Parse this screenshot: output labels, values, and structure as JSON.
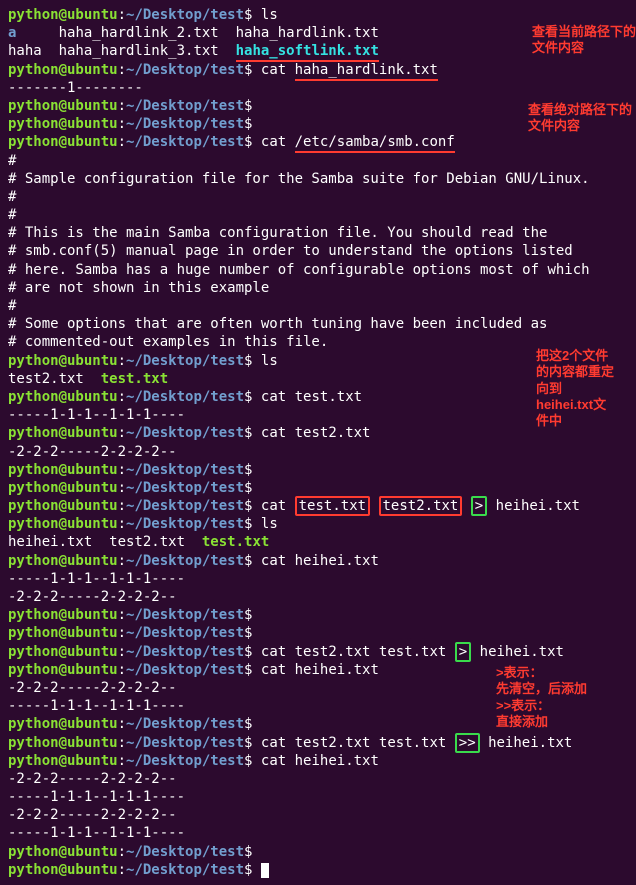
{
  "prompt": {
    "user": "python@ubuntu",
    "sep": ":",
    "path": "~/Desktop/test",
    "sym": "$"
  },
  "cmds": {
    "ls1": "ls",
    "cat_hardlink": "cat ",
    "cat_smb": "cat ",
    "ls2": "ls",
    "cat_test": "cat test.txt",
    "cat_test2": "cat test2.txt",
    "cat_redir": "cat ",
    "ls3": "ls",
    "cat_heihei": "cat heihei.txt",
    "cat_redir2": "cat test2.txt test.txt ",
    "cat_heihei2": "cat heihei.txt",
    "cat_append": "cat test2.txt test.txt ",
    "cat_heihei3": "cat heihei.txt",
    "empty": ""
  },
  "args": {
    "haha_hardlink": "haha_hardlink.txt",
    "smb_conf": "/etc/samba/smb.conf",
    "test_txt": "test.txt",
    "test2_txt": "test2.txt",
    "gt": ">",
    "gtgt": ">>",
    "heihei": " heihei.txt"
  },
  "ls_output1": {
    "a": "a",
    "hl2": "haha_hardlink_2.txt",
    "hl": "haha_hardlink.txt",
    "haha": "haha",
    "hl3": "haha_hardlink_3.txt",
    "sl": "haha_softlink.txt"
  },
  "outputs": {
    "one_line": "-------1--------",
    "hash": "#",
    "samba1": "# Sample configuration file for the Samba suite for Debian GNU/Linux.",
    "samba2": "#",
    "samba3": "# This is the main Samba configuration file. You should read the",
    "samba4": "# smb.conf(5) manual page in order to understand the options listed",
    "samba5": "# here. Samba has a huge number of configurable options most of which",
    "samba6": "# are not shown in this example",
    "samba7": "#",
    "samba8": "# Some options that are often worth tuning have been included as",
    "samba9": "# commented-out examples in this file.",
    "ls2_a": "test2.txt  ",
    "ls2_b": "test.txt",
    "test_out": "-----1-1-1--1-1-1----",
    "test2_out": "-2-2-2-----2-2-2-2--",
    "ls3_a": "heihei.txt  test2.txt  ",
    "ls3_b": "test.txt"
  },
  "annotations": {
    "a1": "查看当前路径下的文件内容",
    "a2": "查看绝对路径下的文件内容",
    "a3_l1": "把这2个文件",
    "a3_l2": "的内容都重定",
    "a3_l3": "向到",
    "a3_l4": "heihei.txt文",
    "a3_l5": "件中",
    "a4_l1": ">表示：",
    "a4_l2": "先清空，后添加",
    "a4_l3": ">>表示：",
    "a4_l4": "直接添加"
  }
}
